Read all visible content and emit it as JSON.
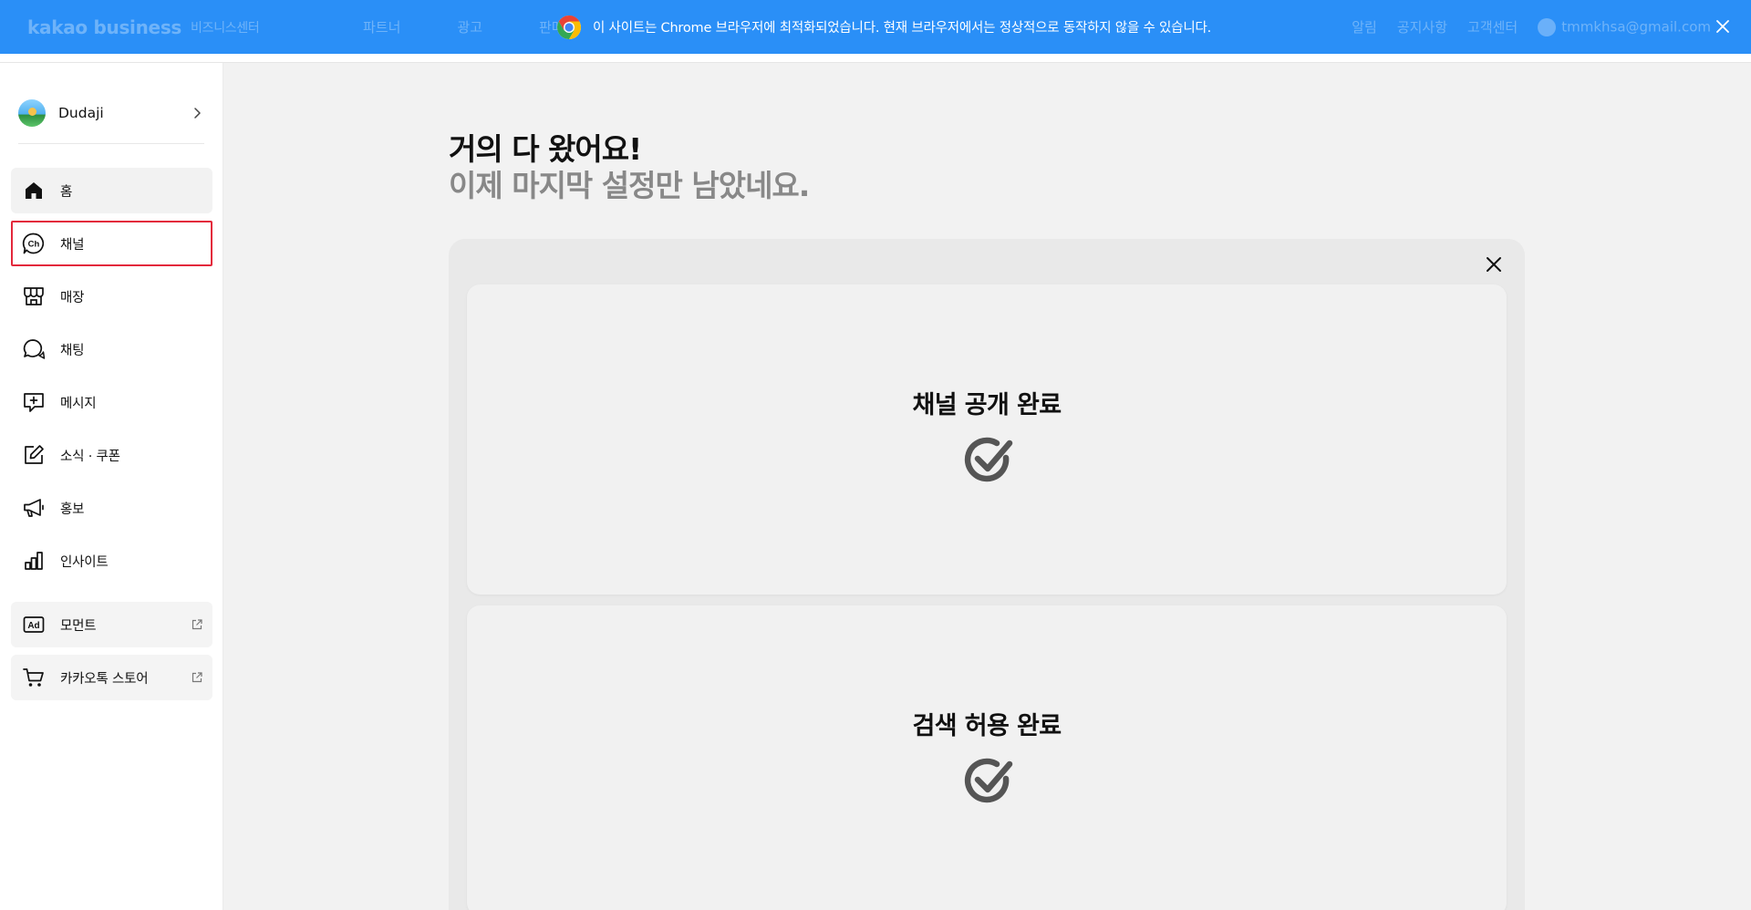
{
  "header": {
    "logo": "kakao business",
    "logo_sub": "비즈니스센터",
    "nav_left": [
      "파트너",
      "광고",
      "판매"
    ],
    "nav_right": [
      "알림",
      "공지사항",
      "고객센터"
    ],
    "user_email": "tmmkhsa@gmail.com"
  },
  "banner": {
    "message": "이 사이트는 Chrome 브라우저에 최적화되었습니다. 현재 브라우저에서는 정상적으로 동작하지 않을 수 있습니다.",
    "close_icon": "close-icon"
  },
  "sidebar": {
    "profile_name": "Dudaji",
    "items": [
      {
        "label": "홈",
        "icon": "home-icon"
      },
      {
        "label": "채널",
        "icon": "channel-icon"
      },
      {
        "label": "매장",
        "icon": "store-icon"
      },
      {
        "label": "채팅",
        "icon": "chat-icon"
      },
      {
        "label": "메시지",
        "icon": "message-icon"
      },
      {
        "label": "소식 · 쿠폰",
        "icon": "edit-icon"
      },
      {
        "label": "홍보",
        "icon": "megaphone-icon"
      },
      {
        "label": "인사이트",
        "icon": "chart-icon"
      }
    ],
    "external": [
      {
        "label": "모먼트",
        "icon": "ad-icon"
      },
      {
        "label": "카카오톡 스토어",
        "icon": "cart-icon"
      }
    ]
  },
  "main": {
    "title": "거의 다 왔어요!",
    "subtitle": "이제 마지막 설정만 남았네요.",
    "cards": [
      {
        "title": "채널 공개 완료"
      },
      {
        "title": "검색 허용 완료"
      }
    ]
  },
  "colors": {
    "banner": "#2a8ff7",
    "highlight": "#e3283b",
    "check": "#555555"
  }
}
